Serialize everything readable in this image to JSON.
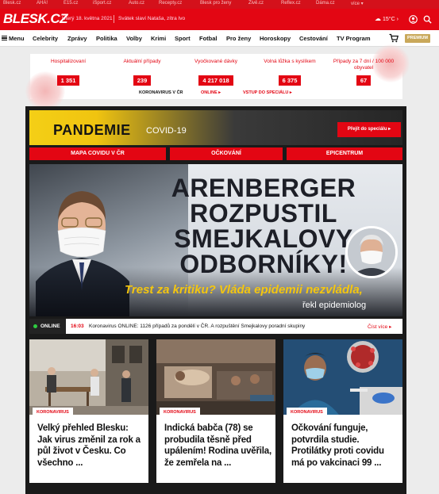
{
  "topbar": {
    "links": [
      "Blesk.cz",
      "AHA!",
      "E15.cz",
      "iSport.cz",
      "Auto.cz",
      "Recepty.cz",
      "Blesk pro ženy",
      "Živě.cz",
      "Reflex.cz",
      "Dáma.cz",
      "více ▾"
    ]
  },
  "header": {
    "logo": "BLESK.CZ",
    "date": "Úterý 18. května 2021",
    "nameday": "Svátek slaví Nataša, zítra Ivo",
    "weather": "15°C ›"
  },
  "nav": {
    "menu_label": "Menu",
    "items": [
      "Celebrity",
      "Zprávy",
      "Politika",
      "Volby",
      "Krimi",
      "Sport",
      "Fotbal",
      "Pro ženy",
      "Horoskopy",
      "Cestování",
      "TV Program"
    ],
    "premium": "PREMIUM"
  },
  "stats": {
    "items": [
      {
        "label": "Hospitalizovaní",
        "value": "1 351"
      },
      {
        "label": "Aktuální případy",
        "value": "239"
      },
      {
        "label": "Vyočkované dávky",
        "value": "4 217 018"
      },
      {
        "label": "Volná lůžka s kyslíkem",
        "value": "6 375"
      },
      {
        "label": "Případy za 7 dní / 100 000 obyvatel",
        "value": "67"
      }
    ],
    "links": [
      "KORONAVIRUS V ČR",
      "ONLINE ▸",
      "VSTUP DO SPECIÁLU ▸"
    ]
  },
  "pandemic": {
    "title": "PANDEMIE",
    "subtitle": "COVID-19",
    "special_button": "Přejít do speciálu ▸",
    "tabs": [
      "MAPA COVIDU V ČR",
      "OČKOVÁNÍ",
      "EPICENTRUM"
    ]
  },
  "hero": {
    "headline": "ARENBERGER ROZPUSTIL SMEJKALOVY ODBORNÍKY!",
    "sub1": "Trest za kritiku? Vláda epidemii nezvládla,",
    "sub2": "řekl epidemiolog"
  },
  "ticker": {
    "live_label": "ONLINE",
    "time": "16:03",
    "text": "Koronavirus ONLINE: 1126 případů za pondělí v ČR. A rozpuštění Smejkalovy poradní skupiny",
    "more": "Číst více ▸"
  },
  "articles": [
    {
      "tag": "KORONAVIRUS",
      "title": "Velký přehled Blesku: Jak virus změnil za rok a půl život v Česku. Co všechno ..."
    },
    {
      "tag": "KORONAVIRUS",
      "title": "Indická babča (78) se probudila těsně před upálením! Rodina uvěřila, že zemřela na ..."
    },
    {
      "tag": "KORONAVIRUS",
      "title": "Očkování funguje, potvrdila studie. Protilátky proti covidu má po vakcinaci 99 ..."
    }
  ],
  "colors": {
    "brand_red": "#e30613",
    "pandemic_yellow": "#f4cf16",
    "dark_panel": "#1a1a1a",
    "premium_gold": "#c9a85a"
  }
}
